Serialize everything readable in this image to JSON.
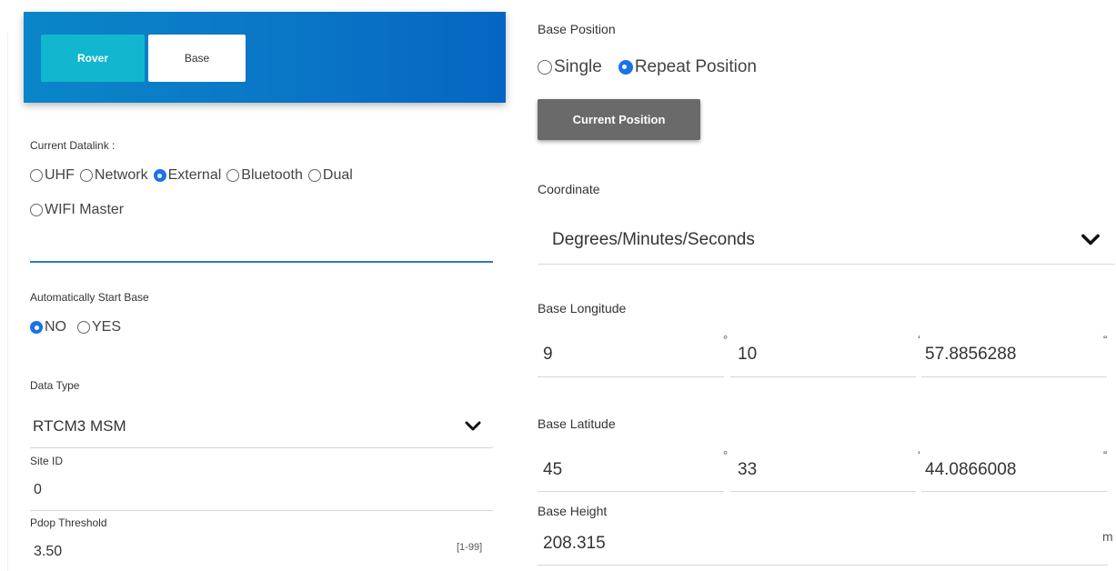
{
  "tabs": {
    "rover": "Rover",
    "base": "Base"
  },
  "datalink": {
    "label": "Current Datalink :",
    "options": [
      "UHF",
      "Network",
      "External",
      "Bluetooth",
      "Dual",
      "WIFI Master"
    ],
    "selected": "External"
  },
  "auto_start": {
    "label": "Automatically Start Base",
    "options": [
      "NO",
      "YES"
    ],
    "selected": "NO"
  },
  "data_type": {
    "label": "Data Type",
    "value": "RTCM3 MSM"
  },
  "site_id": {
    "label": "Site ID",
    "value": "0"
  },
  "pdop": {
    "label": "Pdop Threshold",
    "value": "3.50",
    "range": "[1-99]"
  },
  "base_position": {
    "label": "Base Position",
    "options": [
      "Single",
      "Repeat Position"
    ],
    "selected": "Repeat Position"
  },
  "current_position_button": "Current Position",
  "coordinate": {
    "label": "Coordinate",
    "value": "Degrees/Minutes/Seconds"
  },
  "base_longitude": {
    "label": "Base Longitude",
    "deg": "9",
    "min": "10",
    "sec": "57.8856288"
  },
  "base_latitude": {
    "label": "Base Latitude",
    "deg": "45",
    "min": "33",
    "sec": "44.0866008"
  },
  "dms_symbols": {
    "deg": "°",
    "min": "‘",
    "sec": "“"
  },
  "base_height": {
    "label": "Base Height",
    "value": "208.315",
    "unit": "m"
  },
  "colors": {
    "header": "#0a7ac6",
    "rover_tab": "#12b6cf",
    "radio_checked": "#1a73e8",
    "button": "#6a6a6a"
  },
  "icons": {
    "dropdown": "chevron-down-icon",
    "radio": "radio-icon"
  }
}
